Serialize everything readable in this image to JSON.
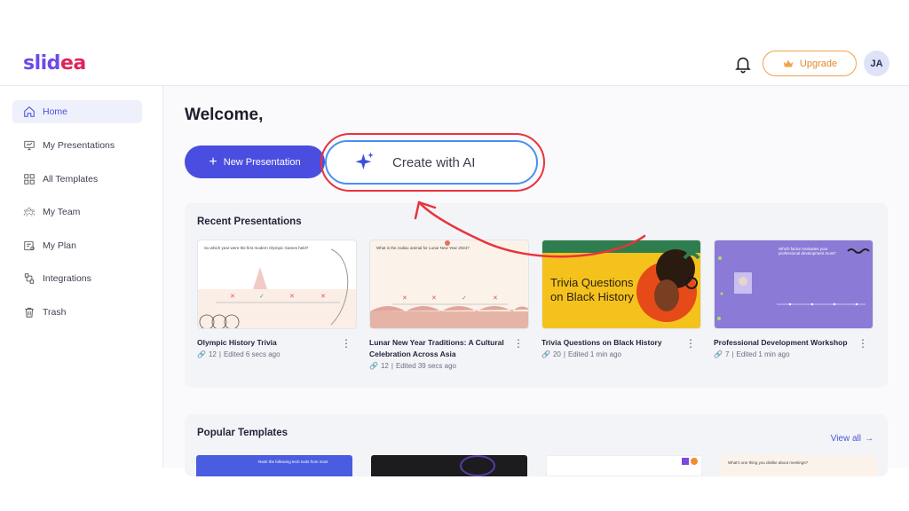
{
  "brand": {
    "part1": "slid",
    "part2": "ea"
  },
  "header": {
    "upgrade_label": "Upgrade",
    "avatar_initials": "JA",
    "icons": [
      "bell-icon",
      "crown-icon"
    ]
  },
  "sidebar": {
    "items": [
      {
        "label": "Home",
        "icon": "home-icon",
        "active": true
      },
      {
        "label": "My Presentations",
        "icon": "presentation-icon"
      },
      {
        "label": "All Templates",
        "icon": "templates-grid-icon"
      },
      {
        "label": "My Team",
        "icon": "team-icon"
      },
      {
        "label": "My Plan",
        "icon": "plan-icon"
      },
      {
        "label": "Integrations",
        "icon": "integrations-icon"
      },
      {
        "label": "Trash",
        "icon": "trash-icon"
      }
    ]
  },
  "main": {
    "welcome": "Welcome,",
    "new_presentation_label": "New Presentation",
    "create_ai_label": "Create with AI",
    "recent_title": "Recent Presentations",
    "popular_title": "Popular Templates",
    "view_all_label": "View all",
    "recent": [
      {
        "title": "Olympic History Trivia",
        "count": "12",
        "edited": "Edited 6 secs ago",
        "thumb_text": "So which year were the first modern Olympic Games held?"
      },
      {
        "title": "Lunar New Year Traditions: A Cultural Celebration Across Asia",
        "count": "12",
        "edited": "Edited 39 secs ago",
        "thumb_text": "What is the zodiac animal for Lunar New Year 2024?"
      },
      {
        "title": "Trivia Questions on Black History",
        "count": "20",
        "edited": "Edited 1 min ago",
        "thumb_text": "Trivia Questions on Black History"
      },
      {
        "title": "Professional Development Workshop",
        "count": "7",
        "edited": "Edited 1 min ago",
        "thumb_text": "Which factor motivates your professional development most?"
      }
    ],
    "popular": [
      {
        "thumb_text": "Rank the following tech tools from most"
      },
      {
        "thumb_text": ""
      },
      {
        "thumb_text": ""
      },
      {
        "thumb_text": "What's one thing you dislike about meetings?"
      }
    ]
  },
  "colors": {
    "primary": "#4a4ee0",
    "ai_border": "#4b8ff0",
    "annotation_red": "#e8343b",
    "upgrade": "#f0a24a",
    "brand_purple": "#6d4ae8",
    "brand_pink": "#e0245e"
  }
}
